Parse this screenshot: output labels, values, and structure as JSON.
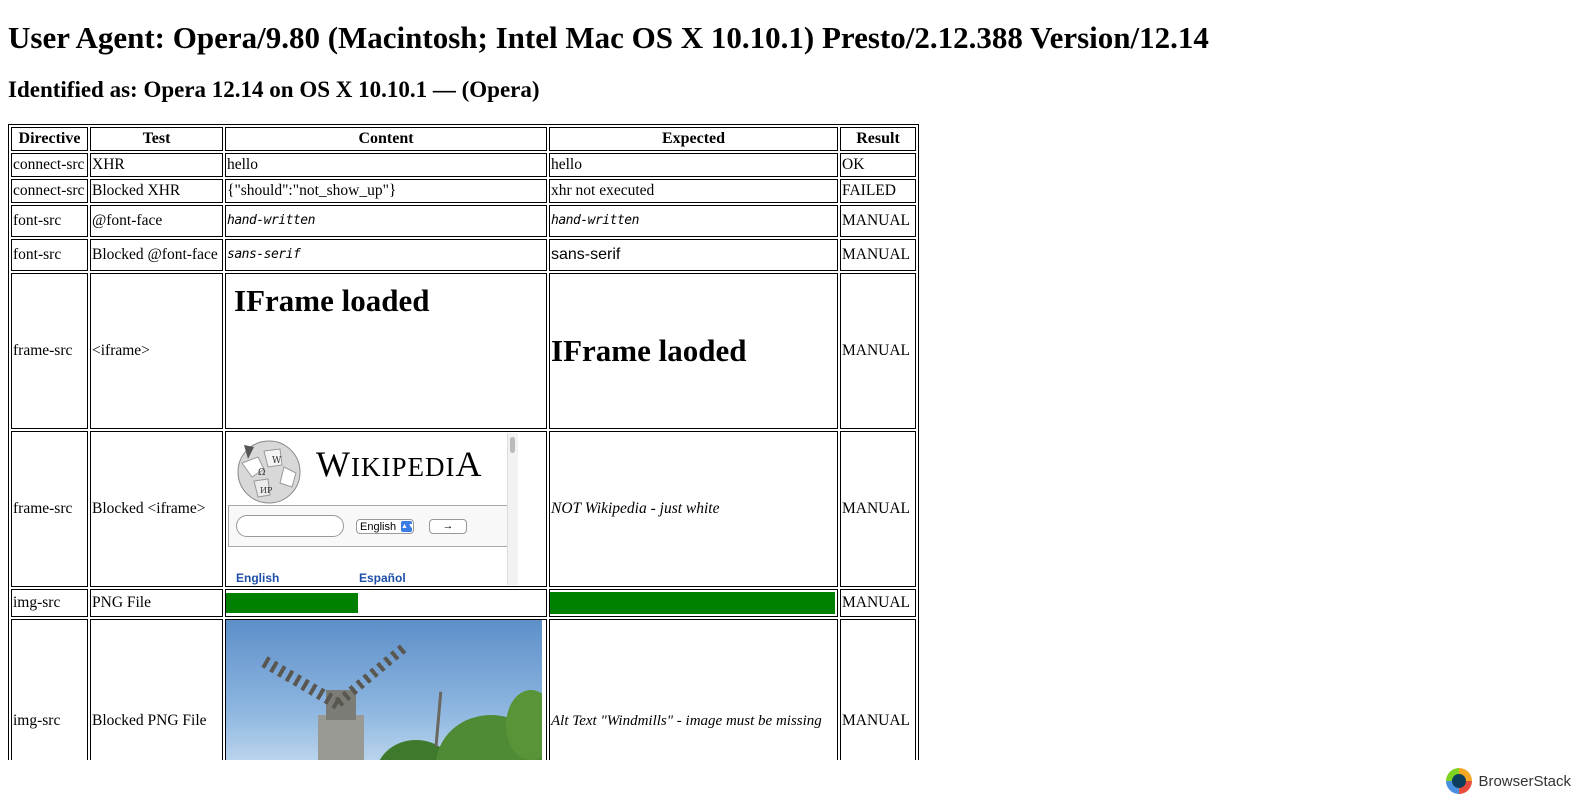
{
  "heading": "User Agent: Opera/9.80 (Macintosh; Intel Mac OS X 10.10.1) Presto/2.12.388 Version/12.14",
  "subheading": "Identified as: Opera 12.14 on OS X 10.10.1 — (Opera)",
  "table": {
    "headers": [
      "Directive",
      "Test",
      "Content",
      "Expected",
      "Result"
    ],
    "rows": [
      {
        "directive": "connect-src",
        "test": "XHR",
        "content": "hello",
        "expected": "hello",
        "result": "OK"
      },
      {
        "directive": "connect-src",
        "test": "Blocked XHR",
        "content": "{\"should\":\"not_show_up\"}",
        "expected": "xhr not executed",
        "result": "FAILED"
      },
      {
        "directive": "font-src",
        "test": "@font-face",
        "content": "hand-written",
        "expected": "hand-written",
        "result": "MANUAL"
      },
      {
        "directive": "font-src",
        "test": "Blocked @font-face",
        "content": "sans-serif",
        "expected": "sans-serif",
        "result": "MANUAL"
      },
      {
        "directive": "frame-src",
        "test": "<iframe>",
        "content": "IFrame loaded",
        "expected": "IFrame laoded",
        "result": "MANUAL"
      },
      {
        "directive": "frame-src",
        "test": "Blocked <iframe>",
        "content": "",
        "expected": "NOT Wikipedia - just white",
        "result": "MANUAL"
      },
      {
        "directive": "img-src",
        "test": "PNG File",
        "content": "",
        "expected": "",
        "result": "MANUAL"
      },
      {
        "directive": "img-src",
        "test": "Blocked PNG File",
        "content": "",
        "expected": "Alt Text \"Windmills\" - image must be missing",
        "result": "MANUAL"
      }
    ]
  },
  "wikipedia_frame": {
    "wordmark": "Wikipedia",
    "language_select": "English",
    "go_button": "→",
    "lang_links": [
      "English",
      "Español"
    ]
  },
  "colors": {
    "green": "#008000",
    "wiki_link": "#1f4fa8"
  },
  "footer": {
    "brand": "BrowserStack"
  }
}
